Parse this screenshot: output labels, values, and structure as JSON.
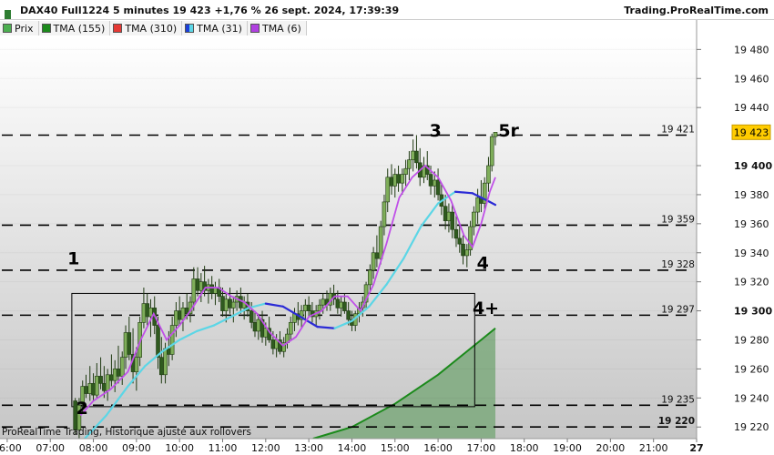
{
  "header": {
    "instrument_title": "DAX40 Full1224 5 minutes 19 423 +1,76 % 26 sept. 2024, 17:39:39",
    "brand": "Trading.ProRealTime.com"
  },
  "legend": [
    {
      "label": "Prix",
      "color": "#4caf50",
      "icon": "candle-icon"
    },
    {
      "label": "TMA (155)",
      "color": "#1b8a1b",
      "icon": "line-icon"
    },
    {
      "label": "TMA (310)",
      "color": "#e53935",
      "icon": "line-icon"
    },
    {
      "label": "TMA (31)",
      "color": "#1e3fd8",
      "icon": "line-icon"
    },
    {
      "label": "TMA (6)",
      "color": "#b040e0",
      "icon": "line-icon"
    }
  ],
  "footer_note": "ProRealTime Trading, Historique ajusté aux rollovers",
  "colors": {
    "up_candle": "#7fae5a",
    "down_candle": "#2f5a1f",
    "tma155": "#1b8a1b",
    "tma155_fill": "#7ca97c",
    "tma31_up": "#5cd6e6",
    "tma31_down": "#2b2bd6",
    "tma6": "#c050e8",
    "last_price_bg": "#ffcc00"
  },
  "chart_data": {
    "type": "candlestick",
    "symbol": "DAX40 Full1224",
    "timeframe": "5 minutes",
    "last_price": 19423,
    "change_pct": "+1,76 %",
    "date": "26 sept. 2024, 17:39:39",
    "ylim": [
      19212,
      19489
    ],
    "y_ticks": [
      {
        "value": 19480,
        "label": "19 480"
      },
      {
        "value": 19460,
        "label": "19 460"
      },
      {
        "value": 19440,
        "label": "19 440"
      },
      {
        "value": 19400,
        "label": "19 400",
        "bold": true
      },
      {
        "value": 19380,
        "label": "19 380"
      },
      {
        "value": 19360,
        "label": "19 360"
      },
      {
        "value": 19340,
        "label": "19 340"
      },
      {
        "value": 19320,
        "label": "19 320"
      },
      {
        "value": 19300,
        "label": "19 300",
        "bold": true
      },
      {
        "value": 19280,
        "label": "19 280"
      },
      {
        "value": 19260,
        "label": "19 260"
      },
      {
        "value": 19240,
        "label": "19 240"
      },
      {
        "value": 19220,
        "label": "19 220"
      }
    ],
    "x_ticks": [
      "06:00",
      "07:00",
      "08:00",
      "09:00",
      "10:00",
      "11:00",
      "12:00",
      "13:00",
      "14:00",
      "15:00",
      "16:00",
      "17:00",
      "18:00",
      "19:00",
      "20:00",
      "21:00",
      "27"
    ],
    "x_tick_hours": [
      6,
      7,
      8,
      9,
      10,
      11,
      12,
      13,
      14,
      15,
      16,
      17,
      18,
      19,
      20,
      21,
      22
    ],
    "xlim_hours": [
      5.833,
      22.0
    ],
    "price_axis_label": {
      "value": 19423,
      "label": "19 423"
    },
    "levels": [
      {
        "value": 19421,
        "label": "19 421"
      },
      {
        "value": 19359,
        "label": "19 359"
      },
      {
        "value": 19328,
        "label": "19 328"
      },
      {
        "value": 19297,
        "label": "19 297"
      },
      {
        "value": 19235,
        "label": "19 235"
      },
      {
        "value": 19220,
        "label": "19 220",
        "bold": true
      }
    ],
    "wave_labels": [
      {
        "text": "1",
        "hour": 7.4,
        "value": 19332
      },
      {
        "text": "2",
        "hour": 7.6,
        "value": 19229
      },
      {
        "text": "3",
        "hour": 15.8,
        "value": 19420
      },
      {
        "text": "4",
        "hour": 16.9,
        "value": 19329
      },
      {
        "text": "4+",
        "hour": 16.8,
        "value": 19298
      },
      {
        "text": "5r",
        "hour": 17.4,
        "value": 19420
      }
    ],
    "range_box": {
      "start_hour": 7.5,
      "end_hour": 16.85,
      "high": 19312,
      "low": 19234
    },
    "ohlc": [
      {
        "t": 7.58,
        "o": 19238,
        "h": 19240,
        "l": 19215,
        "c": 19218
      },
      {
        "t": 7.67,
        "o": 19218,
        "h": 19240,
        "l": 19212,
        "c": 19235
      },
      {
        "t": 7.75,
        "o": 19236,
        "h": 19252,
        "l": 19230,
        "c": 19248
      },
      {
        "t": 7.83,
        "o": 19248,
        "h": 19256,
        "l": 19240,
        "c": 19243
      },
      {
        "t": 7.92,
        "o": 19243,
        "h": 19262,
        "l": 19238,
        "c": 19250
      },
      {
        "t": 8.0,
        "o": 19250,
        "h": 19257,
        "l": 19238,
        "c": 19242
      },
      {
        "t": 8.08,
        "o": 19242,
        "h": 19264,
        "l": 19240,
        "c": 19255
      },
      {
        "t": 8.17,
        "o": 19255,
        "h": 19268,
        "l": 19246,
        "c": 19250
      },
      {
        "t": 8.25,
        "o": 19250,
        "h": 19262,
        "l": 19240,
        "c": 19245
      },
      {
        "t": 8.33,
        "o": 19245,
        "h": 19260,
        "l": 19238,
        "c": 19256
      },
      {
        "t": 8.42,
        "o": 19256,
        "h": 19270,
        "l": 19248,
        "c": 19252
      },
      {
        "t": 8.5,
        "o": 19252,
        "h": 19266,
        "l": 19244,
        "c": 19260
      },
      {
        "t": 8.58,
        "o": 19260,
        "h": 19276,
        "l": 19250,
        "c": 19255
      },
      {
        "t": 8.67,
        "o": 19255,
        "h": 19272,
        "l": 19249,
        "c": 19268
      },
      {
        "t": 8.75,
        "o": 19268,
        "h": 19290,
        "l": 19260,
        "c": 19285
      },
      {
        "t": 8.83,
        "o": 19285,
        "h": 19296,
        "l": 19266,
        "c": 19270
      },
      {
        "t": 8.92,
        "o": 19270,
        "h": 19288,
        "l": 19250,
        "c": 19258
      },
      {
        "t": 9.0,
        "o": 19258,
        "h": 19275,
        "l": 19245,
        "c": 19268
      },
      {
        "t": 9.08,
        "o": 19268,
        "h": 19296,
        "l": 19262,
        "c": 19292
      },
      {
        "t": 9.17,
        "o": 19292,
        "h": 19316,
        "l": 19288,
        "c": 19305
      },
      {
        "t": 9.25,
        "o": 19305,
        "h": 19312,
        "l": 19290,
        "c": 19296
      },
      {
        "t": 9.33,
        "o": 19296,
        "h": 19308,
        "l": 19282,
        "c": 19302
      },
      {
        "t": 9.42,
        "o": 19302,
        "h": 19310,
        "l": 19284,
        "c": 19290
      },
      {
        "t": 9.5,
        "o": 19290,
        "h": 19296,
        "l": 19260,
        "c": 19268
      },
      {
        "t": 9.58,
        "o": 19268,
        "h": 19282,
        "l": 19250,
        "c": 19256
      },
      {
        "t": 9.67,
        "o": 19256,
        "h": 19278,
        "l": 19250,
        "c": 19274
      },
      {
        "t": 9.75,
        "o": 19274,
        "h": 19286,
        "l": 19262,
        "c": 19270
      },
      {
        "t": 9.83,
        "o": 19270,
        "h": 19296,
        "l": 19266,
        "c": 19290
      },
      {
        "t": 9.92,
        "o": 19290,
        "h": 19306,
        "l": 19282,
        "c": 19300
      },
      {
        "t": 10.0,
        "o": 19300,
        "h": 19310,
        "l": 19290,
        "c": 19294
      },
      {
        "t": 10.08,
        "o": 19294,
        "h": 19306,
        "l": 19286,
        "c": 19302
      },
      {
        "t": 10.17,
        "o": 19302,
        "h": 19312,
        "l": 19294,
        "c": 19298
      },
      {
        "t": 10.25,
        "o": 19298,
        "h": 19310,
        "l": 19292,
        "c": 19306
      },
      {
        "t": 10.33,
        "o": 19306,
        "h": 19330,
        "l": 19300,
        "c": 19322
      },
      {
        "t": 10.42,
        "o": 19322,
        "h": 19330,
        "l": 19310,
        "c": 19314
      },
      {
        "t": 10.5,
        "o": 19314,
        "h": 19326,
        "l": 19306,
        "c": 19320
      },
      {
        "t": 10.58,
        "o": 19320,
        "h": 19331,
        "l": 19310,
        "c": 19314
      },
      {
        "t": 10.67,
        "o": 19314,
        "h": 19322,
        "l": 19305,
        "c": 19318
      },
      {
        "t": 10.75,
        "o": 19318,
        "h": 19324,
        "l": 19308,
        "c": 19312
      },
      {
        "t": 10.83,
        "o": 19312,
        "h": 19320,
        "l": 19304,
        "c": 19316
      },
      {
        "t": 10.92,
        "o": 19316,
        "h": 19322,
        "l": 19306,
        "c": 19310
      },
      {
        "t": 11.0,
        "o": 19310,
        "h": 19316,
        "l": 19296,
        "c": 19300
      },
      {
        "t": 11.08,
        "o": 19300,
        "h": 19312,
        "l": 19292,
        "c": 19308
      },
      {
        "t": 11.17,
        "o": 19308,
        "h": 19316,
        "l": 19298,
        "c": 19302
      },
      {
        "t": 11.25,
        "o": 19302,
        "h": 19310,
        "l": 19292,
        "c": 19306
      },
      {
        "t": 11.33,
        "o": 19306,
        "h": 19314,
        "l": 19300,
        "c": 19310
      },
      {
        "t": 11.42,
        "o": 19310,
        "h": 19316,
        "l": 19298,
        "c": 19302
      },
      {
        "t": 11.5,
        "o": 19302,
        "h": 19310,
        "l": 19294,
        "c": 19306
      },
      {
        "t": 11.58,
        "o": 19306,
        "h": 19312,
        "l": 19296,
        "c": 19300
      },
      {
        "t": 11.67,
        "o": 19300,
        "h": 19306,
        "l": 19288,
        "c": 19292
      },
      {
        "t": 11.75,
        "o": 19292,
        "h": 19300,
        "l": 19282,
        "c": 19286
      },
      {
        "t": 11.83,
        "o": 19286,
        "h": 19298,
        "l": 19280,
        "c": 19294
      },
      {
        "t": 11.92,
        "o": 19294,
        "h": 19300,
        "l": 19278,
        "c": 19282
      },
      {
        "t": 12.0,
        "o": 19282,
        "h": 19292,
        "l": 19276,
        "c": 19288
      },
      {
        "t": 12.08,
        "o": 19288,
        "h": 19296,
        "l": 19278,
        "c": 19280
      },
      {
        "t": 12.17,
        "o": 19280,
        "h": 19286,
        "l": 19270,
        "c": 19274
      },
      {
        "t": 12.25,
        "o": 19274,
        "h": 19284,
        "l": 19268,
        "c": 19280
      },
      {
        "t": 12.33,
        "o": 19280,
        "h": 19286,
        "l": 19270,
        "c": 19272
      },
      {
        "t": 12.42,
        "o": 19272,
        "h": 19282,
        "l": 19268,
        "c": 19278
      },
      {
        "t": 12.5,
        "o": 19278,
        "h": 19288,
        "l": 19274,
        "c": 19284
      },
      {
        "t": 12.58,
        "o": 19284,
        "h": 19296,
        "l": 19280,
        "c": 19292
      },
      {
        "t": 12.67,
        "o": 19292,
        "h": 19302,
        "l": 19286,
        "c": 19298
      },
      {
        "t": 12.75,
        "o": 19298,
        "h": 19306,
        "l": 19290,
        "c": 19294
      },
      {
        "t": 12.83,
        "o": 19294,
        "h": 19304,
        "l": 19288,
        "c": 19300
      },
      {
        "t": 12.92,
        "o": 19300,
        "h": 19308,
        "l": 19294,
        "c": 19304
      },
      {
        "t": 13.0,
        "o": 19304,
        "h": 19310,
        "l": 19296,
        "c": 19300
      },
      {
        "t": 13.08,
        "o": 19300,
        "h": 19306,
        "l": 19292,
        "c": 19296
      },
      {
        "t": 13.17,
        "o": 19296,
        "h": 19304,
        "l": 19290,
        "c": 19300
      },
      {
        "t": 13.25,
        "o": 19300,
        "h": 19308,
        "l": 19294,
        "c": 19304
      },
      {
        "t": 13.33,
        "o": 19304,
        "h": 19312,
        "l": 19298,
        "c": 19308
      },
      {
        "t": 13.42,
        "o": 19308,
        "h": 19314,
        "l": 19300,
        "c": 19304
      },
      {
        "t": 13.5,
        "o": 19304,
        "h": 19316,
        "l": 19300,
        "c": 19312
      },
      {
        "t": 13.58,
        "o": 19312,
        "h": 19318,
        "l": 19304,
        "c": 19308
      },
      {
        "t": 13.67,
        "o": 19308,
        "h": 19314,
        "l": 19298,
        "c": 19302
      },
      {
        "t": 13.75,
        "o": 19302,
        "h": 19310,
        "l": 19296,
        "c": 19306
      },
      {
        "t": 13.83,
        "o": 19306,
        "h": 19312,
        "l": 19298,
        "c": 19300
      },
      {
        "t": 13.92,
        "o": 19300,
        "h": 19306,
        "l": 19290,
        "c": 19294
      },
      {
        "t": 14.0,
        "o": 19294,
        "h": 19300,
        "l": 19286,
        "c": 19290
      },
      {
        "t": 14.08,
        "o": 19290,
        "h": 19300,
        "l": 19286,
        "c": 19298
      },
      {
        "t": 14.17,
        "o": 19298,
        "h": 19306,
        "l": 19292,
        "c": 19302
      },
      {
        "t": 14.25,
        "o": 19302,
        "h": 19310,
        "l": 19296,
        "c": 19306
      },
      {
        "t": 14.33,
        "o": 19306,
        "h": 19320,
        "l": 19302,
        "c": 19318
      },
      {
        "t": 14.42,
        "o": 19318,
        "h": 19332,
        "l": 19312,
        "c": 19328
      },
      {
        "t": 14.5,
        "o": 19328,
        "h": 19344,
        "l": 19322,
        "c": 19340
      },
      {
        "t": 14.58,
        "o": 19340,
        "h": 19352,
        "l": 19330,
        "c": 19336
      },
      {
        "t": 14.67,
        "o": 19336,
        "h": 19362,
        "l": 19332,
        "c": 19358
      },
      {
        "t": 14.75,
        "o": 19358,
        "h": 19380,
        "l": 19352,
        "c": 19375
      },
      {
        "t": 14.83,
        "o": 19375,
        "h": 19398,
        "l": 19368,
        "c": 19392
      },
      {
        "t": 14.92,
        "o": 19392,
        "h": 19401,
        "l": 19380,
        "c": 19386
      },
      {
        "t": 15.0,
        "o": 19386,
        "h": 19398,
        "l": 19378,
        "c": 19394
      },
      {
        "t": 15.08,
        "o": 19394,
        "h": 19400,
        "l": 19382,
        "c": 19388
      },
      {
        "t": 15.17,
        "o": 19388,
        "h": 19398,
        "l": 19380,
        "c": 19394
      },
      {
        "t": 15.25,
        "o": 19394,
        "h": 19404,
        "l": 19386,
        "c": 19398
      },
      {
        "t": 15.33,
        "o": 19398,
        "h": 19410,
        "l": 19390,
        "c": 19404
      },
      {
        "t": 15.42,
        "o": 19404,
        "h": 19418,
        "l": 19396,
        "c": 19410
      },
      {
        "t": 15.5,
        "o": 19410,
        "h": 19421,
        "l": 19398,
        "c": 19402
      },
      {
        "t": 15.58,
        "o": 19402,
        "h": 19412,
        "l": 19386,
        "c": 19392
      },
      {
        "t": 15.67,
        "o": 19392,
        "h": 19406,
        "l": 19388,
        "c": 19400
      },
      {
        "t": 15.75,
        "o": 19400,
        "h": 19410,
        "l": 19390,
        "c": 19394
      },
      {
        "t": 15.83,
        "o": 19394,
        "h": 19400,
        "l": 19380,
        "c": 19386
      },
      {
        "t": 15.92,
        "o": 19386,
        "h": 19396,
        "l": 19378,
        "c": 19390
      },
      {
        "t": 16.0,
        "o": 19390,
        "h": 19398,
        "l": 19376,
        "c": 19380
      },
      {
        "t": 16.08,
        "o": 19380,
        "h": 19388,
        "l": 19366,
        "c": 19372
      },
      {
        "t": 16.17,
        "o": 19372,
        "h": 19380,
        "l": 19356,
        "c": 19362
      },
      {
        "t": 16.25,
        "o": 19362,
        "h": 19374,
        "l": 19354,
        "c": 19368
      },
      {
        "t": 16.33,
        "o": 19368,
        "h": 19374,
        "l": 19350,
        "c": 19356
      },
      {
        "t": 16.42,
        "o": 19356,
        "h": 19366,
        "l": 19344,
        "c": 19350
      },
      {
        "t": 16.5,
        "o": 19350,
        "h": 19360,
        "l": 19340,
        "c": 19346
      },
      {
        "t": 16.58,
        "o": 19346,
        "h": 19352,
        "l": 19332,
        "c": 19338
      },
      {
        "t": 16.67,
        "o": 19338,
        "h": 19346,
        "l": 19330,
        "c": 19342
      },
      {
        "t": 16.75,
        "o": 19342,
        "h": 19362,
        "l": 19338,
        "c": 19358
      },
      {
        "t": 16.83,
        "o": 19358,
        "h": 19372,
        "l": 19352,
        "c": 19368
      },
      {
        "t": 16.92,
        "o": 19368,
        "h": 19384,
        "l": 19360,
        "c": 19378
      },
      {
        "t": 17.0,
        "o": 19378,
        "h": 19390,
        "l": 19368,
        "c": 19374
      },
      {
        "t": 17.08,
        "o": 19374,
        "h": 19392,
        "l": 19370,
        "c": 19388
      },
      {
        "t": 17.17,
        "o": 19388,
        "h": 19406,
        "l": 19382,
        "c": 19400
      },
      {
        "t": 17.25,
        "o": 19400,
        "h": 19422,
        "l": 19396,
        "c": 19420
      },
      {
        "t": 17.33,
        "o": 19420,
        "h": 19423,
        "l": 19414,
        "c": 19423
      }
    ],
    "series": [
      {
        "name": "TMA (155)",
        "x": [
          13.1,
          14.0,
          15.0,
          16.0,
          16.5,
          17.0,
          17.33
        ],
        "values": [
          19212,
          19220,
          19236,
          19256,
          19268,
          19280,
          19288
        ]
      },
      {
        "name": "TMA (31)",
        "x": [
          7.8,
          8.3,
          8.8,
          9.2,
          9.6,
          10.0,
          10.4,
          10.8,
          11.2,
          11.6,
          12.0,
          12.4,
          12.8,
          13.2,
          13.6,
          14.0,
          14.4,
          14.8,
          15.2,
          15.6,
          16.0,
          16.4,
          16.8,
          17.0,
          17.2,
          17.33
        ],
        "values": [
          19212,
          19228,
          19248,
          19262,
          19272,
          19280,
          19286,
          19290,
          19296,
          19302,
          19305,
          19303,
          19296,
          19289,
          19288,
          19293,
          19303,
          19318,
          19336,
          19358,
          19374,
          19382,
          19381,
          19378,
          19375,
          19373
        ]
      },
      {
        "name": "TMA (6)",
        "x": [
          7.7,
          8.0,
          8.4,
          8.8,
          9.1,
          9.4,
          9.7,
          10.0,
          10.3,
          10.6,
          10.9,
          11.2,
          11.5,
          11.8,
          12.1,
          12.4,
          12.7,
          13.0,
          13.3,
          13.6,
          13.9,
          14.2,
          14.5,
          14.8,
          15.1,
          15.4,
          15.7,
          16.0,
          16.3,
          16.6,
          16.8,
          17.0,
          17.2,
          17.33
        ],
        "values": [
          19228,
          19238,
          19246,
          19258,
          19280,
          19298,
          19280,
          19290,
          19302,
          19316,
          19316,
          19310,
          19306,
          19298,
          19285,
          19276,
          19282,
          19296,
          19300,
          19310,
          19310,
          19300,
          19318,
          19346,
          19378,
          19392,
          19400,
          19392,
          19376,
          19352,
          19344,
          19360,
          19382,
          19392
        ]
      }
    ]
  }
}
